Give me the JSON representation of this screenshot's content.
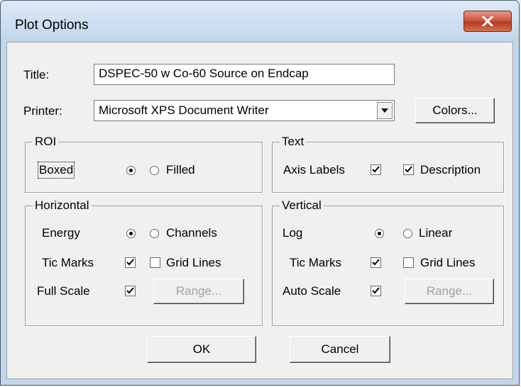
{
  "window": {
    "title": "Plot Options",
    "close_glyph": "close-icon"
  },
  "fields": {
    "title_label": "Title:",
    "title_value": "DSPEC-50 w Co-60 Source on Endcap",
    "printer_label": "Printer:",
    "printer_value": "Microsoft XPS Document Writer",
    "colors_button": "Colors..."
  },
  "roi": {
    "legend": "ROI",
    "option_a": "Boxed",
    "option_b": "Filled",
    "selected": "Boxed"
  },
  "text_group": {
    "legend": "Text",
    "axis_labels": {
      "label": "Axis Labels",
      "checked": true
    },
    "description": {
      "label": "Description",
      "checked": true
    }
  },
  "horizontal": {
    "legend": "Horizontal",
    "option_a": "Energy",
    "option_b": "Channels",
    "selected": "Energy",
    "tic_marks": {
      "label": "Tic Marks",
      "checked": true
    },
    "grid_lines": {
      "label": "Grid Lines",
      "checked": false
    },
    "full_scale": {
      "label": "Full Scale",
      "checked": true
    },
    "range_button": "Range..."
  },
  "vertical": {
    "legend": "Vertical",
    "option_a": "Log",
    "option_b": "Linear",
    "selected": "Log",
    "tic_marks": {
      "label": "Tic Marks",
      "checked": true
    },
    "grid_lines": {
      "label": "Grid Lines",
      "checked": false
    },
    "auto_scale": {
      "label": "Auto Scale",
      "checked": true
    },
    "range_button": "Range..."
  },
  "buttons": {
    "ok": "OK",
    "cancel": "Cancel"
  },
  "colors": {
    "close_button": "#c7462c",
    "dialog_bg": "#f0f0f0",
    "frame": "#c3d7ec"
  }
}
